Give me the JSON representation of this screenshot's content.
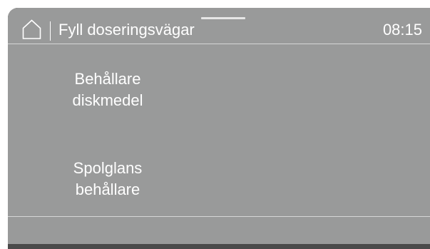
{
  "header": {
    "title": "Fyll doseringsvägar",
    "clock": "08:15",
    "home_icon": "home-icon"
  },
  "menu": {
    "items": [
      {
        "line1": "Behållare",
        "line2": "diskmedel"
      },
      {
        "line1": "Spolglans",
        "line2": "behållare"
      }
    ]
  },
  "colors": {
    "screen_background": "#999a9a",
    "frame": "#4a4a4a",
    "text": "#ffffff",
    "divider": "#d6d6d6"
  }
}
